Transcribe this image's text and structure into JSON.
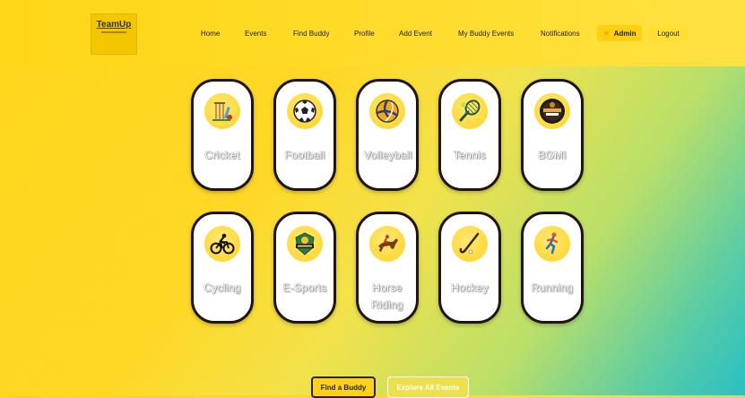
{
  "brand": {
    "name": "TeamUp"
  },
  "nav": {
    "links": [
      "Home",
      "Events",
      "Find Buddy",
      "Profile",
      "Add Event",
      "My Buddy Events",
      "Notifications"
    ],
    "admin": "Admin",
    "logout": "Logout"
  },
  "sports": [
    {
      "label": "Cricket",
      "icon": "cricket-icon"
    },
    {
      "label": "Football",
      "icon": "football-icon"
    },
    {
      "label": "Volleyball",
      "icon": "volleyball-icon"
    },
    {
      "label": "Tennis",
      "icon": "tennis-icon"
    },
    {
      "label": "BGMI",
      "icon": "bgmi-icon"
    },
    {
      "label": "Cycling",
      "icon": "cycling-icon"
    },
    {
      "label": "E-Sports",
      "icon": "esports-icon"
    },
    {
      "label": "Horse Riding",
      "icon": "horse-riding-icon"
    },
    {
      "label": "Hockey",
      "icon": "hockey-icon"
    },
    {
      "label": "Running",
      "icon": "running-icon"
    }
  ],
  "actions": {
    "find_buddy": "Find a Buddy",
    "explore_events": "Explore All Events"
  }
}
